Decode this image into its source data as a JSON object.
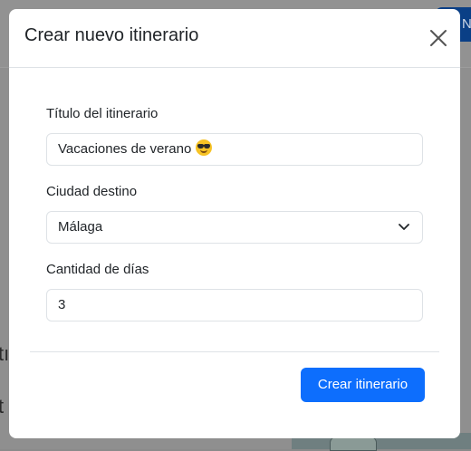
{
  "background": {
    "button_label": "Ne",
    "text_1": "tı",
    "text_2": "t"
  },
  "modal": {
    "title": "Crear nuevo itinerario",
    "close_icon": "close-icon",
    "fields": {
      "title_label": "Título del itinerario",
      "title_value": "Vacaciones de verano",
      "title_emoji": "sunglasses-face-icon",
      "city_label": "Ciudad destino",
      "city_value": "Málaga",
      "days_label": "Cantidad de días",
      "days_value": "3"
    },
    "submit_label": "Crear itinerario"
  },
  "colors": {
    "primary": "#0d6efd",
    "border": "#dee2e6",
    "text": "#212529"
  }
}
